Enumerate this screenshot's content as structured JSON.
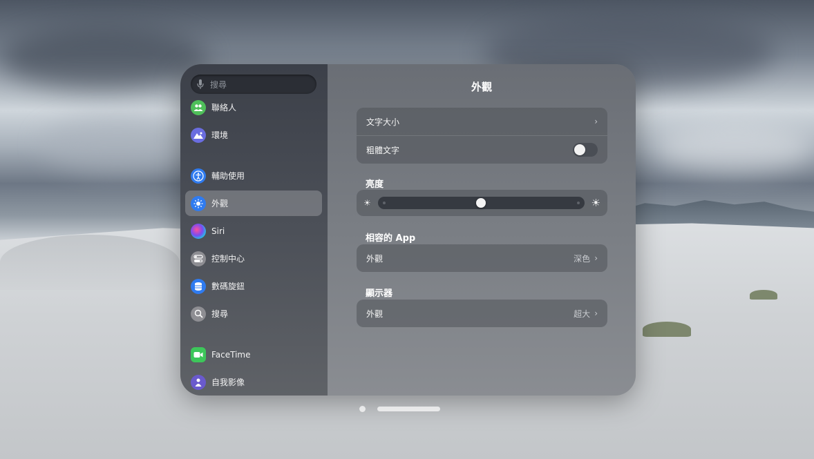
{
  "search": {
    "placeholder": "搜尋"
  },
  "sidebar": {
    "items": [
      {
        "label": "聯絡人",
        "icon": "contacts-icon",
        "color": "#4fbf5a"
      },
      {
        "label": "環境",
        "icon": "environment-icon",
        "color": "#6a6de0"
      },
      {
        "label": "輔助使用",
        "icon": "accessibility-icon",
        "color": "#2f7bf0"
      },
      {
        "label": "外觀",
        "icon": "appearance-icon",
        "color": "#2f7bf0",
        "selected": true
      },
      {
        "label": "Siri",
        "icon": "siri-icon",
        "color": "#2c2c2e"
      },
      {
        "label": "控制中心",
        "icon": "control-center-icon",
        "color": "#8e8e93"
      },
      {
        "label": "數碼旋鈕",
        "icon": "digital-crown-icon",
        "color": "#2f7bf0"
      },
      {
        "label": "搜尋",
        "icon": "search-icon",
        "color": "#8e8e93"
      },
      {
        "label": "FaceTime",
        "icon": "facetime-icon",
        "color": "#3dc65a"
      },
      {
        "label": "自我影像",
        "icon": "persona-icon",
        "color": "#6a5acd"
      }
    ]
  },
  "main": {
    "title": "外觀",
    "text_group": {
      "text_size_label": "文字大小",
      "bold_text_label": "粗體文字",
      "bold_text_on": false
    },
    "brightness": {
      "label": "亮度",
      "level": 0.5
    },
    "compatible_apps": {
      "label": "相容的 App",
      "row_label": "外觀",
      "row_value": "深色"
    },
    "display": {
      "label": "顯示器",
      "row_label": "外觀",
      "row_value": "超大"
    }
  }
}
